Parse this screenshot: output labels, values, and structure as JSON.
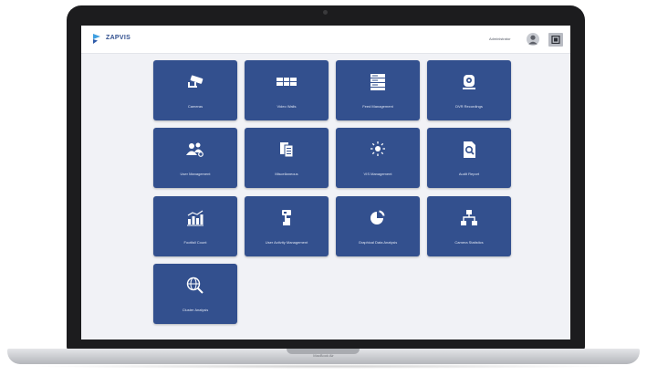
{
  "device": {
    "model_label": "MacBook Air"
  },
  "header": {
    "brand": "ZAPVIS",
    "user_name": "Administrator"
  },
  "tiles": [
    {
      "label": "Cameras",
      "icon": "cctv-camera-icon"
    },
    {
      "label": "Video Walls",
      "icon": "video-wall-icon"
    },
    {
      "label": "Feed Management",
      "icon": "server-rack-icon"
    },
    {
      "label": "DVR Recordings",
      "icon": "dvr-recording-icon"
    },
    {
      "label": "User Management",
      "icon": "users-group-icon"
    },
    {
      "label": "Miscellaneous",
      "icon": "documents-icon"
    },
    {
      "label": "VIS Management",
      "icon": "sun-settings-icon"
    },
    {
      "label": "Audit Report",
      "icon": "report-search-icon"
    },
    {
      "label": "Footfall Count",
      "icon": "bar-chart-icon"
    },
    {
      "label": "User Activity Management",
      "icon": "hand-touch-icon"
    },
    {
      "label": "Graphical Data Analysis",
      "icon": "pie-chart-icon"
    },
    {
      "label": "Camera Statistics",
      "icon": "hierarchy-icon"
    },
    {
      "label": "Cluster Analysis",
      "icon": "globe-search-icon"
    }
  ],
  "colors": {
    "tile_bg": "#33508e",
    "screen_bg": "#f1f2f6",
    "brand": "#32508f"
  }
}
